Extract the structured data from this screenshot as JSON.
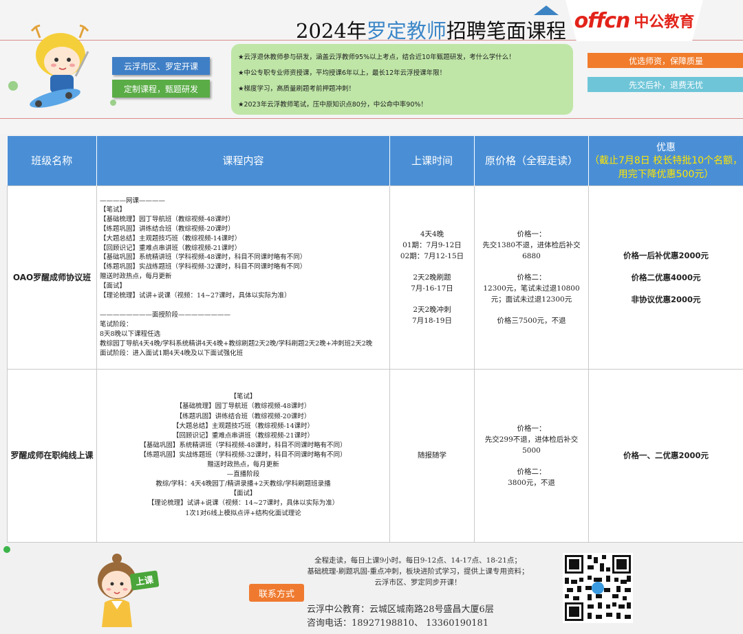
{
  "header": {
    "title_prefix": "2024年",
    "title_highlight": "罗定教师",
    "title_suffix": "招聘笔面课程",
    "logo_offcn": "offcn",
    "logo_brand": "中公教育",
    "pill_left_1": "云浮市区、罗定开课",
    "pill_left_2": "定制课程，甄题研发",
    "pill_right_1": "优选师资，保障质量",
    "pill_right_2": "先交后补，退费无忧",
    "highlights": [
      "★云浮退休教师参与研发，涵盖云浮教师95%以上考点，结合近10年甄题研发，考什么学什么！",
      "★中公专职专业师资授课，平均授课6年以上，最长12年云浮授课年限！",
      "★梯度学习，高质量刷题考前押题冲刺！",
      "★2023年云浮教师笔试，压中原知识点80分，中公命中率90%！"
    ]
  },
  "table": {
    "headers": {
      "class_name": "班级名称",
      "content": "课程内容",
      "time": "上课时间",
      "price": "原价格（全程走读）",
      "discount_title": "优惠",
      "discount_sub": "（截止7月8日 校长特批10个名额，用完下降优惠500元）"
    },
    "rows": [
      {
        "class_name": "OAO罗醒成师协议班",
        "content_lines": [
          "————网课————",
          "【笔试】",
          "【基础梳理】园丁导航班（教综视频-48课时）",
          "【练题巩固】讲练结合班（教综视频-20课时）",
          "【大题总结】主观题技巧班（教综视频-14课时）",
          "【回顾识记】重难点串讲班（教综视频-21课时）",
          "【基础巩固】系统精讲班（学科视频-48课时，科目不同课时略有不同）",
          "【练题巩固】实战练题班（学科视频-32课时，科目不同课时略有不同）",
          "赠送时政热点，每月更新",
          "【面试】",
          "【理论梳理】试讲+说课（视频：14~27课时，具体以实际为准）",
          "",
          "————————面授阶段————————",
          "笔试阶段：",
          "8天8晚以下课程任选",
          "教综园丁导航4天4晚/学科系统精讲4天4晚+教综刷题2天2晚/学科刷题2天2晚+冲刺班2天2晚",
          "面试阶段：进入面试1期4天4晚及以下面试强化班"
        ],
        "time_lines": [
          "4天4晚",
          "01期：7月9-12日",
          "02期：7月12-15日",
          "",
          "2天2晚刷题",
          "7月-16-17日",
          "",
          "2天2晚冲刺",
          "7月18-19日"
        ],
        "price_lines": [
          "价格一：",
          "先交1380不退，进体检后补交6880",
          "",
          "价格二：",
          "12300元，笔试未过退10800元；面试未过退12300元",
          "",
          "价格三7500元，不退"
        ],
        "discount_lines": [
          "价格一后补优惠2000元",
          "价格二优惠4000元",
          "非协议优惠2000元"
        ]
      },
      {
        "class_name": "罗醒成师在职纯线上课",
        "content_lines": [
          "【笔试】",
          "【基础梳理】园丁导航班（教综视频-48课时）",
          "【练题巩固】讲练结合班（教综视频-20课时）",
          "【大题总结】主观题技巧班（教综视频-14课时）",
          "【回顾识记】重难点串讲班（教综视频-21课时）",
          "【基础巩固】系统精讲班（学科视频-48课时，科目不同课时略有不同）",
          "【练题巩固】实战练题班（学科视频-32课时，科目不同课时略有不同）",
          "赠送时政热点，每月更新",
          "—直播阶段",
          "教综/学科：4天4晚园丁/精讲录播+2天教综/学科刷题班录播",
          "【面试】",
          "【理论梳理】试讲+说课（视频：14~27课时，具体以实际为准）",
          "1次1对6线上模拟点评+结构化面试理论"
        ],
        "time_lines": [
          "随报随学"
        ],
        "price_lines": [
          "价格一：",
          "先交299不退，进体检后补交5000",
          "",
          "价格二：",
          "3800元，不退"
        ],
        "discount_lines": [
          "价格一、二优惠2000元"
        ]
      }
    ]
  },
  "footer": {
    "desc_lines": [
      "全程走读，每日上课9小时。每日9-12点、14-17点、18-21点；",
      "基础梳理-刷题巩固-重点冲刺，板块进阶式学习，提供上课专用资料；",
      "云浮市区、罗定同步开课！"
    ],
    "contact_label": "联系方式",
    "address": "云浮中公教育：云城区城南路28号盛昌大厦6层",
    "phone": "咨询电话：18927198810、 13360190181",
    "badge_text": "上课"
  },
  "colors": {
    "header_blue": "#4a8fd6",
    "discount_yellow": "#ffe600",
    "green_box": "#bfe6a7",
    "pill_blue": "#3f7fc6",
    "pill_green": "#5aac46",
    "bar_orange": "#f07c2c",
    "bar_cyan": "#6ec5d8",
    "brand_red": "#e2231a"
  }
}
